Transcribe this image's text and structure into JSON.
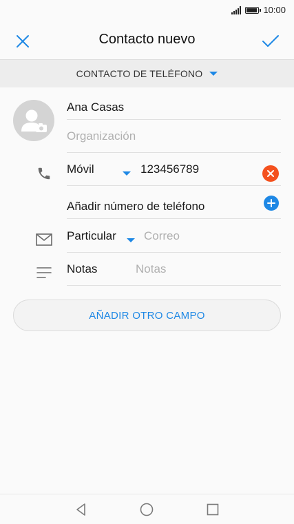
{
  "status_bar": {
    "time": "10:00"
  },
  "header": {
    "title": "Contacto nuevo",
    "close_icon": "close-icon",
    "save_icon": "check-icon"
  },
  "account": {
    "label": "CONTACTO DE TELÉFONO"
  },
  "name_field": {
    "value": "Ana Casas"
  },
  "organization_field": {
    "placeholder": "Organización"
  },
  "phone": {
    "type_label": "Móvil",
    "number": "123456789",
    "add_label": "Añadir número de teléfono"
  },
  "email": {
    "type_label": "Particular",
    "placeholder": "Correo"
  },
  "notes": {
    "label": "Notas",
    "placeholder": "Notas"
  },
  "add_field": {
    "label": "AÑADIR OTRO CAMPO"
  },
  "colors": {
    "accent": "#1e88e5",
    "delete": "#f4511e",
    "avatar_bg": "#d4d4d4"
  }
}
